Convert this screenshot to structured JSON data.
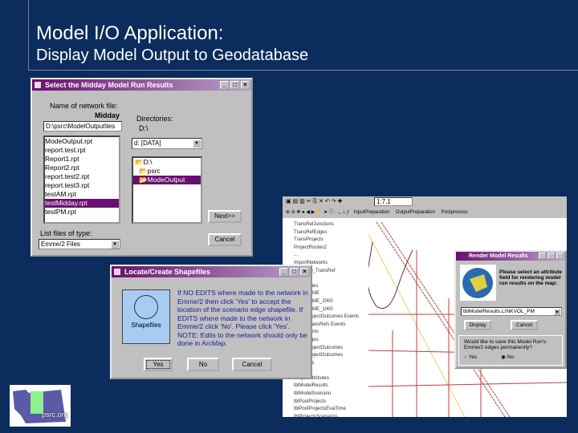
{
  "slide": {
    "title": "Model I/O Application:",
    "subtitle": "Display Model Output to Geodatabase"
  },
  "dialog1": {
    "title": "Select the Midday Model Run Results",
    "network_label": "Name of network file:",
    "period": "Midday",
    "path_value": "D:\\psrc\\ModelOutput\\tes",
    "files": [
      "ModeOutput.rpt",
      "report.test.rpt",
      "Report1.rpt",
      "Report2.rpt",
      "report.test2.rpt",
      "report.test3.rpt",
      "testAM.rpt",
      "testMidday.rpt",
      "testPM.rpt"
    ],
    "selected_file": "testMidday.rpt",
    "dir_label": "Directories:",
    "dir_value": "D:\\",
    "drive": "d: [DATA]",
    "folders": [
      "D:\\",
      "psrc",
      "ModeOutput"
    ],
    "selected_folder": "ModeOutput",
    "filetype_label": "List files of type:",
    "filetype": "Emme/2 Files",
    "next": "Next>>",
    "cancel": "Cancel"
  },
  "dialog2": {
    "title": "Locate/Create Shapefiles",
    "icon_label": "Shapefiles",
    "message": "If NO EDITS where made to the network in Emme/2 then click 'Yes' to accept the location of the scenario edge shapefile. If EDITS where made to the network in Emme/2 click 'No'. Please click 'Yes'. NOTE: Edits to the network should only be done in ArcMap.",
    "yes": "Yes",
    "no": "No",
    "cancel": "Cancel"
  },
  "arcmap": {
    "scale": "1:7,1",
    "toolbar_items": [
      "InputPreparation",
      "OutputPreparation",
      "Postprocess"
    ],
    "toc": [
      "TransRefJunctions",
      "TransRefEdges",
      "TransProjects",
      "ProjectRoutes2",
      "...",
      "ImportNetworks",
      "Scenario_TransRef",
      "Tolls",
      "Boundaries",
      "LinksEMME",
      "LinksEMME_2000",
      "LinksEMME_1000",
      "TransProjectOutcomes Events",
      "MergeTransRefs Events",
      "Movements",
      "Link_edges",
      "TransProjectOutcomes",
      "TransProjectOutcomes",
      "Attributes",
      "Projects",
      "ProjectAttributes",
      "tblModelResults",
      "tblModelScenario",
      "tblPoolProjects",
      "tblPoolProjectsEvalTime",
      "tblProjectsScenarios",
      "tblModelResultsLookup"
    ]
  },
  "dialog3": {
    "title": "Render Model Results",
    "prompt": "Please select an attribute field for rendering model run results on the map:",
    "field": "tblModelResults.LINKVOL_PM",
    "display": "Display",
    "cancel": "Cancel",
    "save_question": "Would like to save this Model Run's Emme/2 edges permanently?",
    "yes": "Yes",
    "no": "No",
    "selected": "No"
  },
  "logo": {
    "text": "psrc.org"
  },
  "colors": {
    "background": "#0b2c5c",
    "titlebar": "#6a0f6f"
  }
}
